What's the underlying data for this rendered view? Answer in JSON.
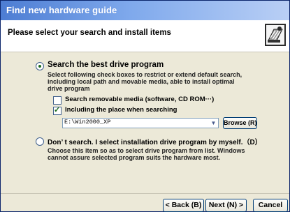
{
  "window": {
    "title": "Find new hardware guide"
  },
  "header": {
    "heading": "Please select your search and install items",
    "icon": "hardware-wizard-icon"
  },
  "option_search": {
    "label": "Search the best drive program",
    "selected": true,
    "description": "Select following check boxes to restrict or extend default search, including local path and movable media, able to install optimal drive program",
    "checkbox_removable": {
      "label": "Search removable media (software, CD ROM···)",
      "checked": false
    },
    "checkbox_place": {
      "label": "Including the place when searching",
      "checked": true
    },
    "path_value": "E:\\Win2000_XP",
    "browse_label": "Browse (R)"
  },
  "option_manual": {
    "label": "Don’ t search. I select installation drive program by myself.（D）",
    "selected": false,
    "description": "Choose this item so as to select drive program from list. Windows cannot assure selected program suits the hardware most."
  },
  "footer": {
    "back_label": "< Back (B)",
    "next_label": "Next (N) >",
    "cancel_label": "Cancel"
  },
  "colors": {
    "title_gradient_start": "#4d7dd3",
    "title_gradient_end": "#b9cff5",
    "dialog_background": "#ece9d8",
    "header_background": "#ffffff"
  }
}
